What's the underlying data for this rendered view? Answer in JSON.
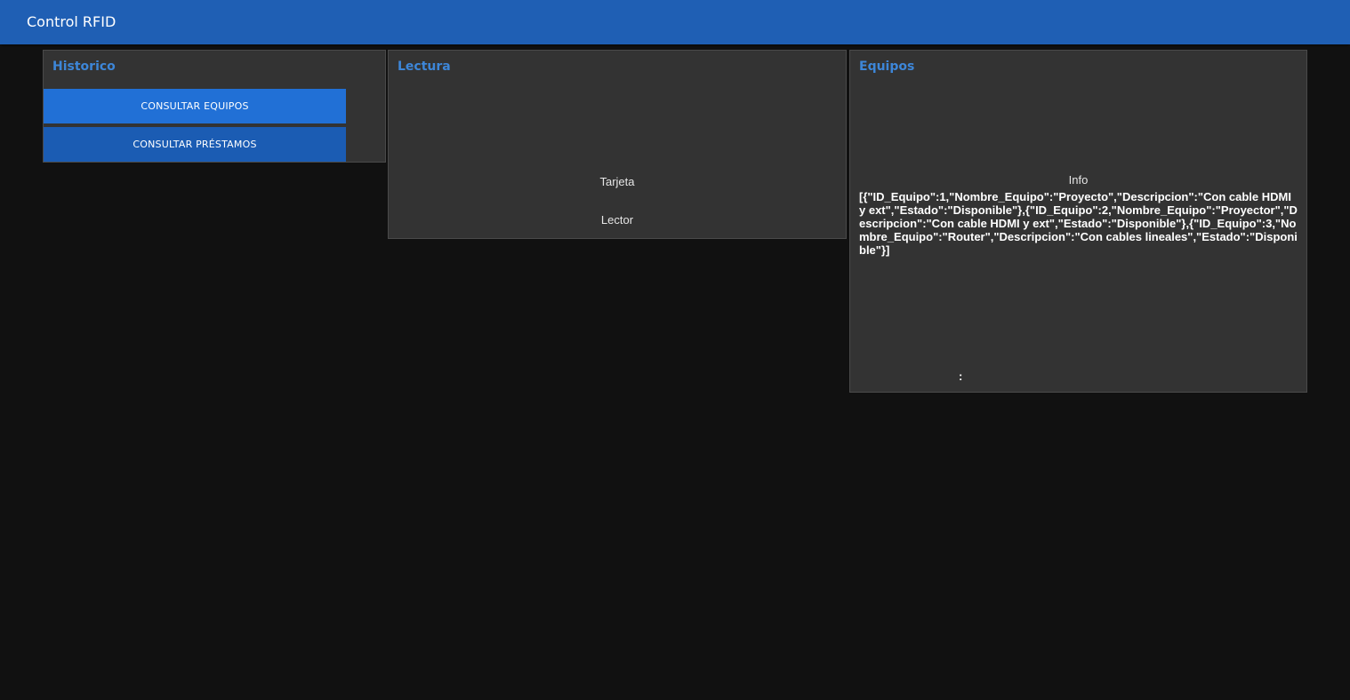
{
  "header": {
    "title": "Control RFID"
  },
  "historico": {
    "title": "Historico",
    "btn_equipos": "CONSULTAR EQUIPOS",
    "btn_prestamos": "CONSULTAR PRÉSTAMOS"
  },
  "lectura": {
    "title": "Lectura",
    "tarjeta": "Tarjeta",
    "lector": "Lector"
  },
  "equipos": {
    "title": "Equipos",
    "info_label": "Info",
    "info_json": "[{\"ID_Equipo\":1,\"Nombre_Equipo\":\"Proyecto\",\"Descripcion\":\"Con cable HDMI y ext\",\"Estado\":\"Disponible\"},{\"ID_Equipo\":2,\"Nombre_Equipo\":\"Proyector\",\"Descripcion\":\"Con cable HDMI y ext\",\"Estado\":\"Disponible\"},{\"ID_Equipo\":3,\"Nombre_Equipo\":\"Router\",\"Descripcion\":\"Con cables lineales\",\"Estado\":\"Disponible\"}]",
    "footer_colon": ":"
  },
  "colors": {
    "topbar": "#1f5fb4",
    "background": "#111111",
    "panel": "#333333",
    "accent_title": "#3d86d8",
    "button_primary": "#2170d6",
    "button_secondary": "#1b5cb3"
  }
}
